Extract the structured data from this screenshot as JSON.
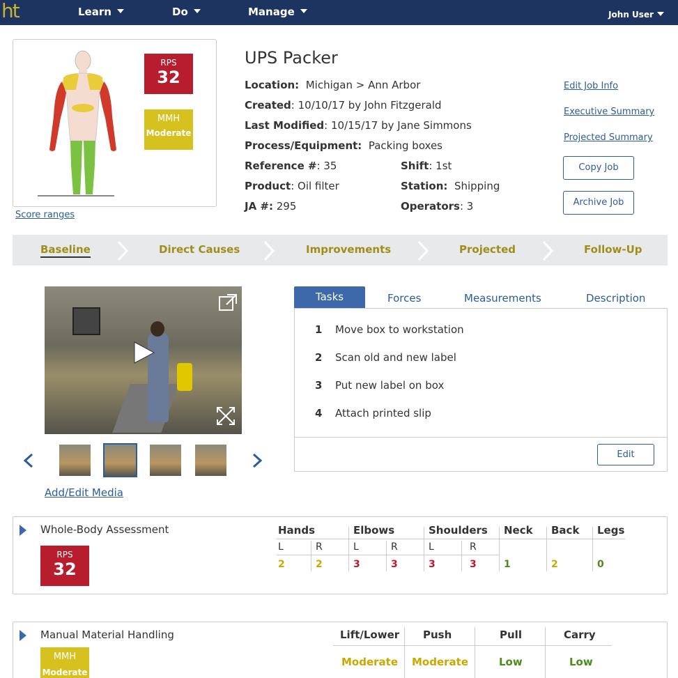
{
  "nav": {
    "logo": "ht",
    "items": [
      "Learn",
      "Do",
      "Manage"
    ],
    "user": "John User"
  },
  "scores": {
    "rps_label": "RPS",
    "rps_value": "32",
    "mmh_label": "MMH",
    "mmh_value": "Moderate",
    "score_ranges": "Score ranges"
  },
  "job": {
    "title": "UPS Packer",
    "location_label": "Location:",
    "location": "Michigan > Ann Arbor",
    "created_label": "Created",
    "created": ": 10/10/17 by John Fitzgerald",
    "modified_label": "Last Modified",
    "modified": ": 10/15/17 by Jane Simmons",
    "process_label": "Process/Equipment:",
    "process": "Packing boxes",
    "reference_label": "Reference #",
    "reference": ": 35",
    "shift_label": "Shift",
    "shift": ": 1st",
    "product_label": "Product",
    "product": ": Oil filter",
    "station_label": "Station:",
    "station": "Shipping",
    "ja_label": "JA #:",
    "ja": "295",
    "operators_label": "Operators",
    "operators": ": 3"
  },
  "actions": {
    "edit_job_info": "Edit Job Info",
    "executive_summary": "Executive Summary",
    "projected_summary": "Projected Summary",
    "copy_job": "Copy Job",
    "archive_job": "Archive Job"
  },
  "stepper": [
    "Baseline",
    "Direct Causes",
    "Improvements",
    "Projected",
    "Follow-Up"
  ],
  "media": {
    "add_edit": "Add/Edit Media"
  },
  "tabs": [
    "Tasks",
    "Forces",
    "Measurements",
    "Description"
  ],
  "tasks": [
    {
      "num": "1",
      "text": "Move box to workstation"
    },
    {
      "num": "2",
      "text": "Scan old and new label"
    },
    {
      "num": "3",
      "text": "Put new label on box"
    },
    {
      "num": "4",
      "text": "Attach printed slip"
    }
  ],
  "tasks_edit": "Edit",
  "whole_body": {
    "title": "Whole-Body Assessment",
    "rps_label": "RPS",
    "rps_value": "32",
    "headers": [
      "Hands",
      "Elbows",
      "Shoulders",
      "Neck",
      "Back",
      "Legs"
    ],
    "lr": [
      "L",
      "R",
      "L",
      "R",
      "L",
      "R"
    ],
    "values": [
      "2",
      "2",
      "3",
      "3",
      "3",
      "3",
      "1",
      "2",
      "0"
    ]
  },
  "mmh": {
    "title": "Manual Material Handling",
    "label": "MMH",
    "value": "Moderate",
    "headers": [
      "Lift/Lower",
      "Push",
      "Pull",
      "Carry"
    ],
    "values": [
      "Moderate",
      "Moderate",
      "Low",
      "Low"
    ]
  },
  "colors": {
    "nav_bg": "#1d3461",
    "accent_blue": "#3d68aa",
    "red": "#b81d2e",
    "yellow": "#d7c11e",
    "green": "#4f8a1f",
    "step_gold": "#a08e1a"
  }
}
